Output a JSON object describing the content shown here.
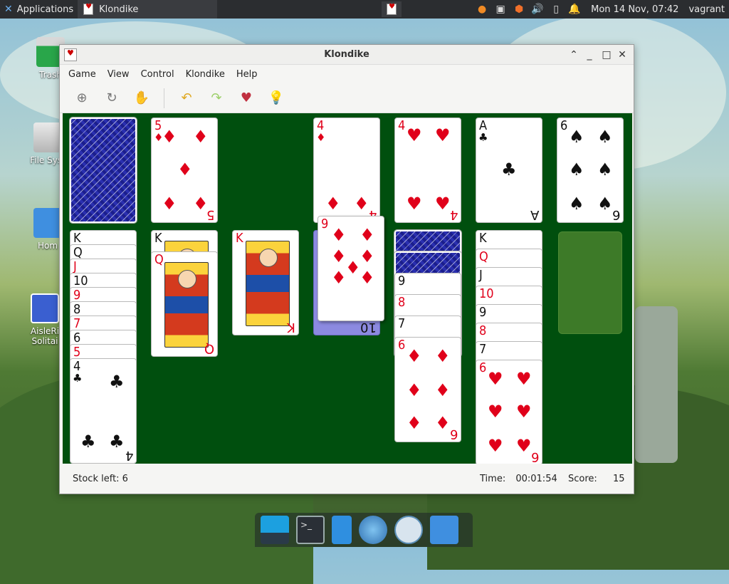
{
  "panel": {
    "applications": "Applications",
    "task_title": "Klondike",
    "clock": "Mon 14 Nov, 07:42",
    "user": "vagrant"
  },
  "desktop_icons": [
    {
      "label": "Trash",
      "icon": "trash-icon"
    },
    {
      "label": "File Syst",
      "icon": "drive-icon"
    },
    {
      "label": "Hom",
      "icon": "home-folder-icon"
    },
    {
      "label": "AisleRi Solitai",
      "icon": "solitaire-icon"
    }
  ],
  "window": {
    "title": "Klondike",
    "menu": [
      "Game",
      "View",
      "Control",
      "Klondike",
      "Help"
    ],
    "toolbar": [
      "new-game-icon",
      "restart-icon",
      "hand-icon",
      "undo-icon",
      "redo-icon",
      "deal-icon",
      "hint-icon"
    ]
  },
  "board": {
    "stock_back": true,
    "waste": {
      "rank": "5",
      "suit": "♦"
    },
    "foundations": [
      {
        "rank": "4",
        "suit": "♦"
      },
      {
        "rank": "4",
        "suit": "♥"
      },
      {
        "rank": "A",
        "suit": "♣"
      },
      {
        "rank": "6",
        "suit": "♠"
      }
    ],
    "tableau_labels": {
      "col1": [
        "K",
        "Q",
        "J",
        "10",
        "9",
        "8",
        "7",
        "6",
        "5",
        "4"
      ],
      "col2": [
        "K",
        "Q"
      ],
      "col3": [
        "K"
      ],
      "col4": [
        "9",
        "10"
      ],
      "col5": [
        "9",
        "8",
        "7",
        "6"
      ],
      "col6": [
        "K",
        "Q",
        "J",
        "10",
        "9",
        "8",
        "7",
        "6"
      ]
    },
    "dragging": {
      "rank": "9",
      "suit": "♦"
    }
  },
  "status": {
    "stock": "Stock left: 6",
    "time_label": "Time:",
    "time_value": "00:01:54",
    "score_label": "Score:",
    "score_value": "15"
  },
  "colors": {
    "felt": "#004f0e",
    "red": "#e0001a",
    "black": "#111111",
    "back": "#1b1e8c"
  }
}
